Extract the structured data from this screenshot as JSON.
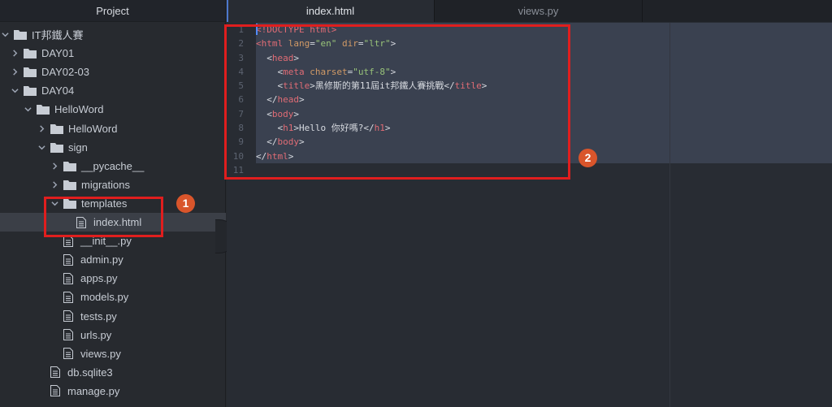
{
  "sidebar": {
    "title": "Project",
    "items": [
      {
        "label": "IT邦鐵人賽",
        "type": "folder",
        "expanded": true,
        "depth": 0
      },
      {
        "label": "DAY01",
        "type": "folder",
        "expanded": false,
        "depth": 1
      },
      {
        "label": "DAY02-03",
        "type": "folder",
        "expanded": false,
        "depth": 1
      },
      {
        "label": "DAY04",
        "type": "folder",
        "expanded": true,
        "depth": 1
      },
      {
        "label": "HelloWord",
        "type": "folder",
        "expanded": true,
        "depth": 2
      },
      {
        "label": "HelloWord",
        "type": "folder",
        "expanded": false,
        "depth": 3
      },
      {
        "label": "sign",
        "type": "folder",
        "expanded": true,
        "depth": 3
      },
      {
        "label": "__pycache__",
        "type": "folder",
        "expanded": false,
        "depth": 4
      },
      {
        "label": "migrations",
        "type": "folder",
        "expanded": false,
        "depth": 4
      },
      {
        "label": "templates",
        "type": "folder",
        "expanded": true,
        "depth": 4
      },
      {
        "label": "index.html",
        "type": "file",
        "depth": 5,
        "selected": true
      },
      {
        "label": "__init__.py",
        "type": "file",
        "depth": 4
      },
      {
        "label": "admin.py",
        "type": "file",
        "depth": 4
      },
      {
        "label": "apps.py",
        "type": "file",
        "depth": 4
      },
      {
        "label": "models.py",
        "type": "file",
        "depth": 4
      },
      {
        "label": "tests.py",
        "type": "file",
        "depth": 4
      },
      {
        "label": "urls.py",
        "type": "file",
        "depth": 4
      },
      {
        "label": "views.py",
        "type": "file",
        "depth": 4
      },
      {
        "label": "db.sqlite3",
        "type": "file",
        "depth": 3
      },
      {
        "label": "manage.py",
        "type": "file",
        "depth": 3
      }
    ]
  },
  "tabs": [
    {
      "label": "index.html",
      "active": true
    },
    {
      "label": "views.py",
      "active": false
    }
  ],
  "editor": {
    "line_numbers": [
      "1",
      "2",
      "3",
      "4",
      "5",
      "6",
      "7",
      "8",
      "9",
      "10",
      "11"
    ],
    "lines": [
      [
        {
          "c": "tag",
          "t": "<!DOCTYPE html>"
        }
      ],
      [
        {
          "c": "tag",
          "t": "<html "
        },
        {
          "c": "attr",
          "t": "lang"
        },
        {
          "c": "txt",
          "t": "="
        },
        {
          "c": "str",
          "t": "\"en\""
        },
        {
          "c": "txt",
          "t": " "
        },
        {
          "c": "attr",
          "t": "dir"
        },
        {
          "c": "txt",
          "t": "="
        },
        {
          "c": "str",
          "t": "\"ltr\""
        },
        {
          "c": "txt",
          "t": ">"
        }
      ],
      [
        {
          "c": "txt",
          "t": "  <"
        },
        {
          "c": "tag",
          "t": "head"
        },
        {
          "c": "txt",
          "t": ">"
        }
      ],
      [
        {
          "c": "txt",
          "t": "    <"
        },
        {
          "c": "tag",
          "t": "meta "
        },
        {
          "c": "attr",
          "t": "charset"
        },
        {
          "c": "txt",
          "t": "="
        },
        {
          "c": "str",
          "t": "\"utf-8\""
        },
        {
          "c": "txt",
          "t": ">"
        }
      ],
      [
        {
          "c": "txt",
          "t": "    <"
        },
        {
          "c": "tag",
          "t": "title"
        },
        {
          "c": "txt",
          "t": ">黑修斯的第11屆it邦鐵人賽挑戰</"
        },
        {
          "c": "tag",
          "t": "title"
        },
        {
          "c": "txt",
          "t": ">"
        }
      ],
      [
        {
          "c": "txt",
          "t": "  </"
        },
        {
          "c": "tag",
          "t": "head"
        },
        {
          "c": "txt",
          "t": ">"
        }
      ],
      [
        {
          "c": "txt",
          "t": "  <"
        },
        {
          "c": "tag",
          "t": "body"
        },
        {
          "c": "txt",
          "t": ">"
        }
      ],
      [
        {
          "c": "txt",
          "t": "    <"
        },
        {
          "c": "tag",
          "t": "h1"
        },
        {
          "c": "txt",
          "t": ">Hello 你好嗎?</"
        },
        {
          "c": "tag",
          "t": "h1"
        },
        {
          "c": "txt",
          "t": ">"
        }
      ],
      [
        {
          "c": "txt",
          "t": "  </"
        },
        {
          "c": "tag",
          "t": "body"
        },
        {
          "c": "txt",
          "t": ">"
        }
      ],
      [
        {
          "c": "txt",
          "t": "</"
        },
        {
          "c": "tag",
          "t": "html"
        },
        {
          "c": "txt",
          "t": ">"
        }
      ],
      []
    ]
  },
  "annotations": {
    "badge1": "1",
    "badge2": "2",
    "color": "#e01e1e",
    "badge_color": "#d9552b"
  }
}
